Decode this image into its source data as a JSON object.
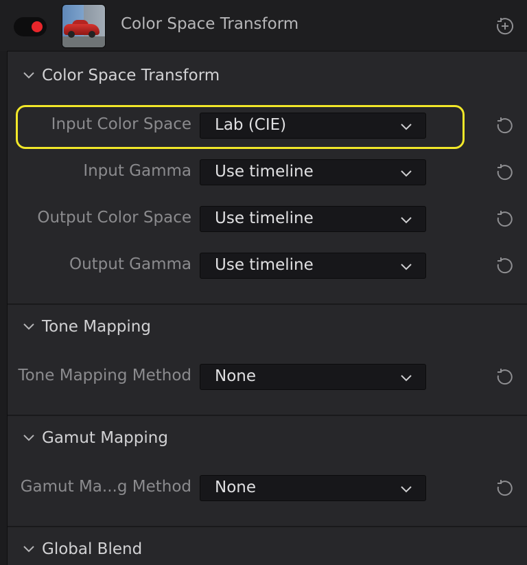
{
  "header": {
    "title": "Color Space Transform",
    "toggle_state": "on",
    "accent_color": "#e8262b"
  },
  "sections": {
    "cst": {
      "title": "Color Space Transform",
      "rows": [
        {
          "label": "Input Color Space",
          "value": "Lab (CIE)"
        },
        {
          "label": "Input Gamma",
          "value": "Use timeline"
        },
        {
          "label": "Output Color Space",
          "value": "Use timeline"
        },
        {
          "label": "Output Gamma",
          "value": "Use timeline"
        }
      ]
    },
    "tone": {
      "title": "Tone Mapping",
      "rows": [
        {
          "label": "Tone Mapping Method",
          "value": "None"
        }
      ]
    },
    "gamut": {
      "title": "Gamut Mapping",
      "rows": [
        {
          "label": "Gamut Ma...g Method",
          "value": "None"
        }
      ]
    },
    "blend": {
      "title": "Global Blend"
    }
  },
  "highlight_color": "#f2e829",
  "icons": [
    "chevron-down-icon",
    "reset-icon",
    "add-node-icon"
  ]
}
